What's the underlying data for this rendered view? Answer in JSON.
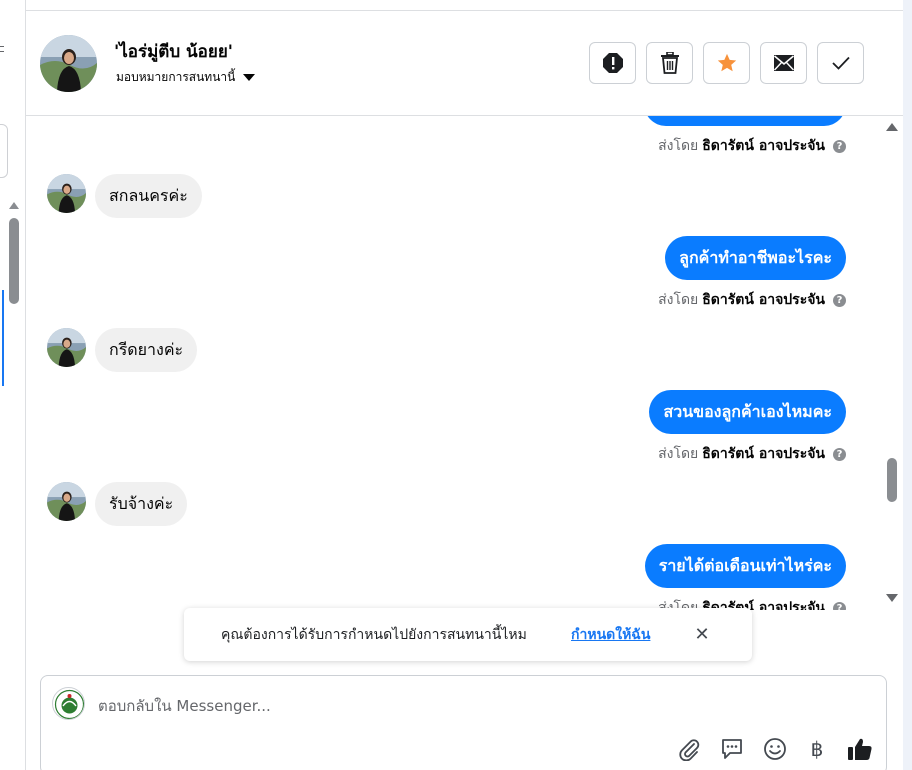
{
  "header": {
    "contact_name": "'ไอร่มู่ตีบ น้อยย'",
    "assign_label": "มอบหมายการสนทนานี้",
    "buttons": [
      {
        "name": "spam-button",
        "icon": "alert-octagon-icon"
      },
      {
        "name": "delete-button",
        "icon": "trash-icon"
      },
      {
        "name": "star-button",
        "icon": "star-icon",
        "color": "#f7923b"
      },
      {
        "name": "mark-unread-button",
        "icon": "envelope-icon"
      },
      {
        "name": "mark-done-button",
        "icon": "check-icon"
      }
    ]
  },
  "messages": {
    "sent_by_prefix": "ส่งโดย",
    "sent_by_name": "ธิดารัตน์ อาจประจัน",
    "incoming": [
      {
        "text": "สกลนครค่ะ"
      },
      {
        "text": "กรีดยางค่ะ"
      },
      {
        "text": "รับจ้างค่ะ"
      }
    ],
    "outgoing": [
      {
        "text": "ลูกค้าทำอาชีพอะไรคะ"
      },
      {
        "text": "สวนของลูกค้าเองไหมคะ"
      },
      {
        "text": "รายได้ต่อเดือนเท่าไหร่คะ"
      }
    ],
    "help_glyph": "?"
  },
  "toast": {
    "text": "คุณต้องการได้รับการกำหนดไปยังการสนทนานี้ไหม",
    "link": "กำหนดให้ฉัน",
    "close_glyph": "✕"
  },
  "composer": {
    "placeholder": "ตอบกลับใน Messenger...",
    "icons": [
      "paperclip-icon",
      "saved-reply-icon",
      "emoji-icon",
      "baht-icon",
      "like-icon"
    ],
    "baht_glyph": "฿"
  },
  "colors": {
    "accent": "#0a7cff",
    "link": "#1877f2",
    "star": "#f7923b",
    "bubble_in": "#f0f0f0"
  }
}
